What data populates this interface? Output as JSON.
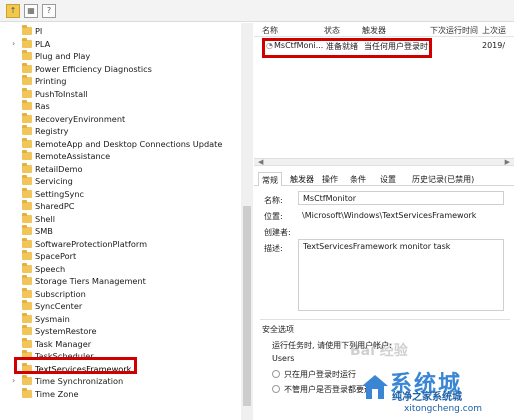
{
  "toolbar": {
    "icons": [
      "folder-up-icon",
      "properties-icon",
      "help-icon"
    ]
  },
  "tree": {
    "items": [
      {
        "label": "PI",
        "expandable": false
      },
      {
        "label": "PLA",
        "expandable": true
      },
      {
        "label": "Plug and Play",
        "expandable": false
      },
      {
        "label": "Power Efficiency Diagnostics",
        "expandable": false
      },
      {
        "label": "Printing",
        "expandable": false
      },
      {
        "label": "PushToInstall",
        "expandable": false
      },
      {
        "label": "Ras",
        "expandable": false
      },
      {
        "label": "RecoveryEnvironment",
        "expandable": false
      },
      {
        "label": "Registry",
        "expandable": false
      },
      {
        "label": "RemoteApp and Desktop Connections Update",
        "expandable": false
      },
      {
        "label": "RemoteAssistance",
        "expandable": false
      },
      {
        "label": "RetailDemo",
        "expandable": false
      },
      {
        "label": "Servicing",
        "expandable": false
      },
      {
        "label": "SettingSync",
        "expandable": false
      },
      {
        "label": "SharedPC",
        "expandable": false
      },
      {
        "label": "Shell",
        "expandable": false
      },
      {
        "label": "SMB",
        "expandable": false
      },
      {
        "label": "SoftwareProtectionPlatform",
        "expandable": false
      },
      {
        "label": "SpacePort",
        "expandable": false
      },
      {
        "label": "Speech",
        "expandable": false
      },
      {
        "label": "Storage Tiers Management",
        "expandable": false
      },
      {
        "label": "Subscription",
        "expandable": false
      },
      {
        "label": "SyncCenter",
        "expandable": false
      },
      {
        "label": "Sysmain",
        "expandable": false
      },
      {
        "label": "SystemRestore",
        "expandable": false
      },
      {
        "label": "Task Manager",
        "expandable": false
      },
      {
        "label": "TaskScheduler",
        "expandable": false
      },
      {
        "label": "TextServicesFramework",
        "expandable": false,
        "selected": true
      },
      {
        "label": "Time Synchronization",
        "expandable": true
      },
      {
        "label": "Time Zone",
        "expandable": false
      }
    ]
  },
  "task_list": {
    "columns": [
      "名称",
      "状态",
      "触发器",
      "下次运行时间",
      "上次运"
    ],
    "rows": [
      {
        "name": "MsCtfMoni...",
        "status": "准备就绪",
        "trigger": "当任何用户登录时",
        "next_run": "",
        "last_run": "2019/"
      }
    ]
  },
  "detail_tabs": [
    "常规",
    "触发器",
    "操作",
    "条件",
    "设置",
    "历史记录(已禁用)"
  ],
  "general": {
    "name_label": "名称:",
    "name_value": "MsCtfMonitor",
    "location_label": "位置:",
    "location_value": "\\Microsoft\\Windows\\TextServicesFramework",
    "author_label": "创建者:",
    "author_value": "",
    "description_label": "描述:",
    "description_value": "TextServicesFramework monitor task"
  },
  "security": {
    "group_title": "安全选项",
    "run_as_label": "运行任务时, 请使用下列用户帐户:",
    "run_as_value": "Users",
    "option_logged_on": "只在用户登录时运行",
    "option_whether": "不管用户是否登录都要运"
  },
  "watermark": {
    "big": "系统城",
    "small": "纯净之家系统城",
    "url": "xitongcheng.com",
    "baidu": "Bai 经验"
  },
  "colors": {
    "highlight_border": "#d00000",
    "folder": "#f1c55a",
    "watermark_blue": "#3a86d4"
  }
}
